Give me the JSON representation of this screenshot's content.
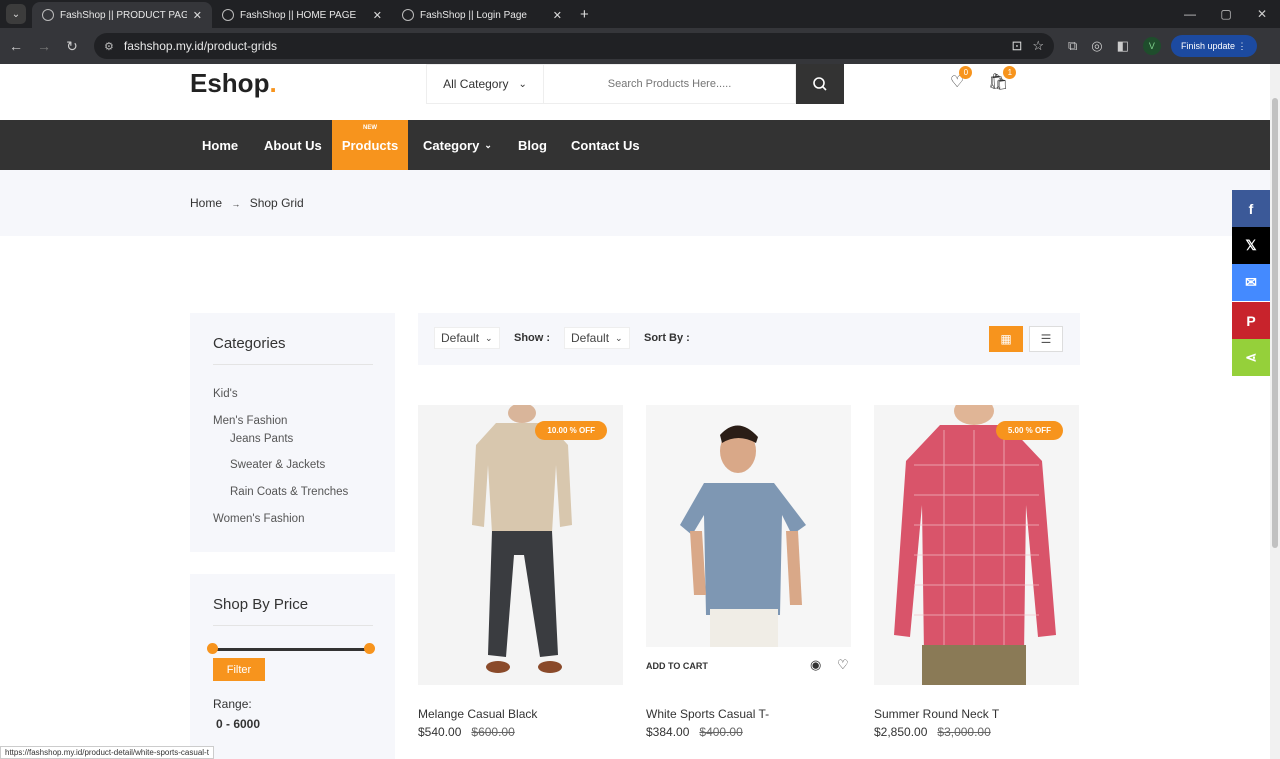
{
  "browser": {
    "tabs": [
      {
        "title": "FashShop || PRODUCT PAGE",
        "active": true
      },
      {
        "title": "FashShop || HOME PAGE",
        "active": false
      },
      {
        "title": "FashShop || Login Page",
        "active": false
      }
    ],
    "url": "fashshop.my.id/product-grids",
    "profile_initial": "V",
    "finish_update": "Finish update",
    "status_url": "https://fashshop.my.id/product-detail/white-sports-casual-t"
  },
  "header": {
    "logo": "Eshop",
    "logo_dot": ".",
    "category_select": "All Category",
    "search_placeholder": "Search Products Here.....",
    "wishlist_count": "0",
    "cart_count": "1"
  },
  "nav": {
    "items": [
      "Home",
      "About Us",
      "Products",
      "Category",
      "Blog",
      "Contact Us"
    ],
    "new_tag": "NEW",
    "active": "Products"
  },
  "breadcrumb": {
    "home": "Home",
    "arrow": "→",
    "current": "Shop Grid"
  },
  "sidebar": {
    "categories_title": "Categories",
    "categories": [
      {
        "label": "Kid's",
        "sub": false
      },
      {
        "label": "Men's Fashion",
        "sub": false
      },
      {
        "label": "Jeans Pants",
        "sub": true
      },
      {
        "label": "Sweater & Jackets",
        "sub": true
      },
      {
        "label": "Rain Coats & Trenches",
        "sub": true
      },
      {
        "label": "Women's Fashion",
        "sub": false
      }
    ],
    "price_title": "Shop By Price",
    "filter_label": "Filter",
    "range_label": "Range:",
    "range_value": "0 - 6000"
  },
  "toolbar": {
    "show_select": "Default",
    "show_label": "Show :",
    "sort_select": "Default",
    "sort_label": "Sort By :",
    "grid_view": "grid-view",
    "list_view": "list-view"
  },
  "products": [
    {
      "name": "Melange Casual Black",
      "price": "$540.00",
      "old_price": "$600.00",
      "discount": "10.00 % OFF"
    },
    {
      "name": "White Sports Casual T-",
      "price": "$384.00",
      "old_price": "$400.00",
      "discount": "",
      "add_to_cart": "ADD TO CART"
    },
    {
      "name": "Summer Round Neck T",
      "price": "$2,850.00",
      "old_price": "$3,000.00",
      "discount": "5.00 % OFF"
    }
  ],
  "share": {
    "items": [
      {
        "icon": "facebook-icon",
        "glyph": "f",
        "color": "#3b5998"
      },
      {
        "icon": "x-icon",
        "glyph": "𝕏",
        "color": "#000000"
      },
      {
        "icon": "messenger-icon",
        "glyph": "✉",
        "color": "#448aff"
      },
      {
        "icon": "pinterest-icon",
        "glyph": "P",
        "color": "#c8232c"
      },
      {
        "icon": "share-icon",
        "glyph": "⋖",
        "color": "#95d03a"
      }
    ]
  },
  "colors": {
    "accent": "#f7941d",
    "nav_bg": "#333333",
    "light_bg": "#f6f7fb"
  }
}
